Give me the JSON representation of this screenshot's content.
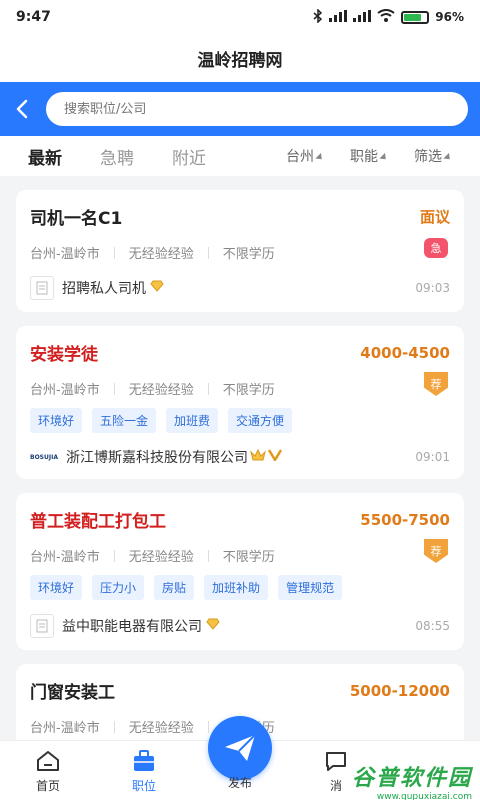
{
  "status": {
    "time": "9:47",
    "battery": "96%"
  },
  "header": {
    "title": "温岭招聘网"
  },
  "search": {
    "placeholder": "搜索职位/公司"
  },
  "tabs": [
    {
      "label": "最新"
    },
    {
      "label": "急聘"
    },
    {
      "label": "附近"
    }
  ],
  "filters": [
    {
      "label": "台州"
    },
    {
      "label": "职能"
    },
    {
      "label": "筛选"
    }
  ],
  "jobs": [
    {
      "title": "司机一名C1",
      "salary": "面议",
      "location": "台州-温岭市",
      "experience": "无经验经验",
      "education": "不限学历",
      "badge": "急",
      "tags": [],
      "company": "招聘私人司机",
      "time": "09:03"
    },
    {
      "title": "安装学徒",
      "salary": "4000-4500",
      "location": "台州-温岭市",
      "experience": "无经验经验",
      "education": "不限学历",
      "badge": "荐",
      "tags": [
        "环境好",
        "五险一金",
        "加班费",
        "交通方便"
      ],
      "company": "浙江博斯嘉科技股份有限公司",
      "company_logo_text": "BOSUJIA",
      "time": "09:01"
    },
    {
      "title": "普工装配工打包工",
      "salary": "5500-7500",
      "location": "台州-温岭市",
      "experience": "无经验经验",
      "education": "不限学历",
      "badge": "荐",
      "tags": [
        "环境好",
        "压力小",
        "房贴",
        "加班补助",
        "管理规范"
      ],
      "company": "益中职能电器有限公司",
      "time": "08:55"
    },
    {
      "title": "门窗安装工",
      "salary": "5000-12000",
      "location": "台州-温岭市",
      "experience": "无经验经验",
      "education": "不限学历"
    }
  ],
  "nav": [
    {
      "label": "首页"
    },
    {
      "label": "职位"
    },
    {
      "label": "发布"
    },
    {
      "label": "消"
    }
  ],
  "watermark": {
    "title": "谷普软件园",
    "url": "www.gupuxiazai.com"
  },
  "colors": {
    "primary": "#2979ff",
    "salary": "#e07b1a",
    "urgent_title": "#d21f1f",
    "badge_ji": "#f4546b",
    "badge_jian": "#f2a23a"
  }
}
